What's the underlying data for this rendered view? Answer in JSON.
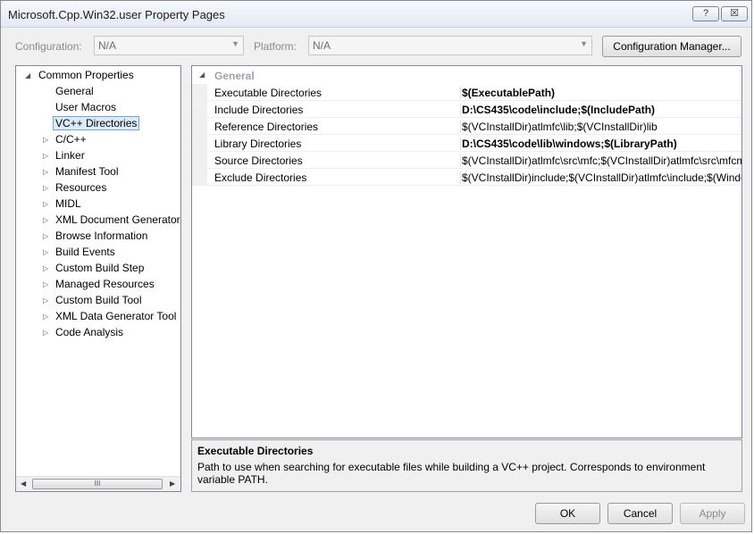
{
  "window": {
    "title": "Microsoft.Cpp.Win32.user Property Pages",
    "help_glyph": "?",
    "close_glyph": "☒"
  },
  "toolbar": {
    "configuration_label": "Configuration:",
    "configuration_value": "N/A",
    "platform_label": "Platform:",
    "platform_value": "N/A",
    "config_manager_label": "Configuration Manager..."
  },
  "tree": {
    "root": {
      "label": "Common Properties",
      "expander": "◢"
    },
    "children": [
      {
        "label": "General"
      },
      {
        "label": "User Macros"
      },
      {
        "label": "VC++ Directories",
        "selected": true
      }
    ],
    "collapsed": [
      {
        "label": "C/C++"
      },
      {
        "label": "Linker"
      },
      {
        "label": "Manifest Tool"
      },
      {
        "label": "Resources"
      },
      {
        "label": "MIDL"
      },
      {
        "label": "XML Document Generator"
      },
      {
        "label": "Browse Information"
      },
      {
        "label": "Build Events"
      },
      {
        "label": "Custom Build Step"
      },
      {
        "label": "Managed Resources"
      },
      {
        "label": "Custom Build Tool"
      },
      {
        "label": "XML Data Generator Tool"
      },
      {
        "label": "Code Analysis"
      }
    ],
    "scroll_thumb_grip": "III"
  },
  "grid": {
    "category": "General",
    "rows": [
      {
        "name": "Executable Directories",
        "value": "$(ExecutablePath)",
        "bold": true
      },
      {
        "name": "Include Directories",
        "value": "D:\\CS435\\code\\include;$(IncludePath)",
        "bold": true
      },
      {
        "name": "Reference Directories",
        "value": "$(VCInstallDir)atlmfc\\lib;$(VCInstallDir)lib",
        "bold": false
      },
      {
        "name": "Library Directories",
        "value": "D:\\CS435\\code\\lib\\windows;$(LibraryPath)",
        "bold": true
      },
      {
        "name": "Source Directories",
        "value": "$(VCInstallDir)atlmfc\\src\\mfc;$(VCInstallDir)atlmfc\\src\\mfcm;",
        "bold": false
      },
      {
        "name": "Exclude Directories",
        "value": "$(VCInstallDir)include;$(VCInstallDir)atlmfc\\include;$(Windo",
        "bold": false
      }
    ]
  },
  "description": {
    "title": "Executable Directories",
    "text": "Path to use when searching for executable files while building a VC++ project.  Corresponds to environment variable PATH."
  },
  "buttons": {
    "ok": "OK",
    "cancel": "Cancel",
    "apply": "Apply"
  }
}
